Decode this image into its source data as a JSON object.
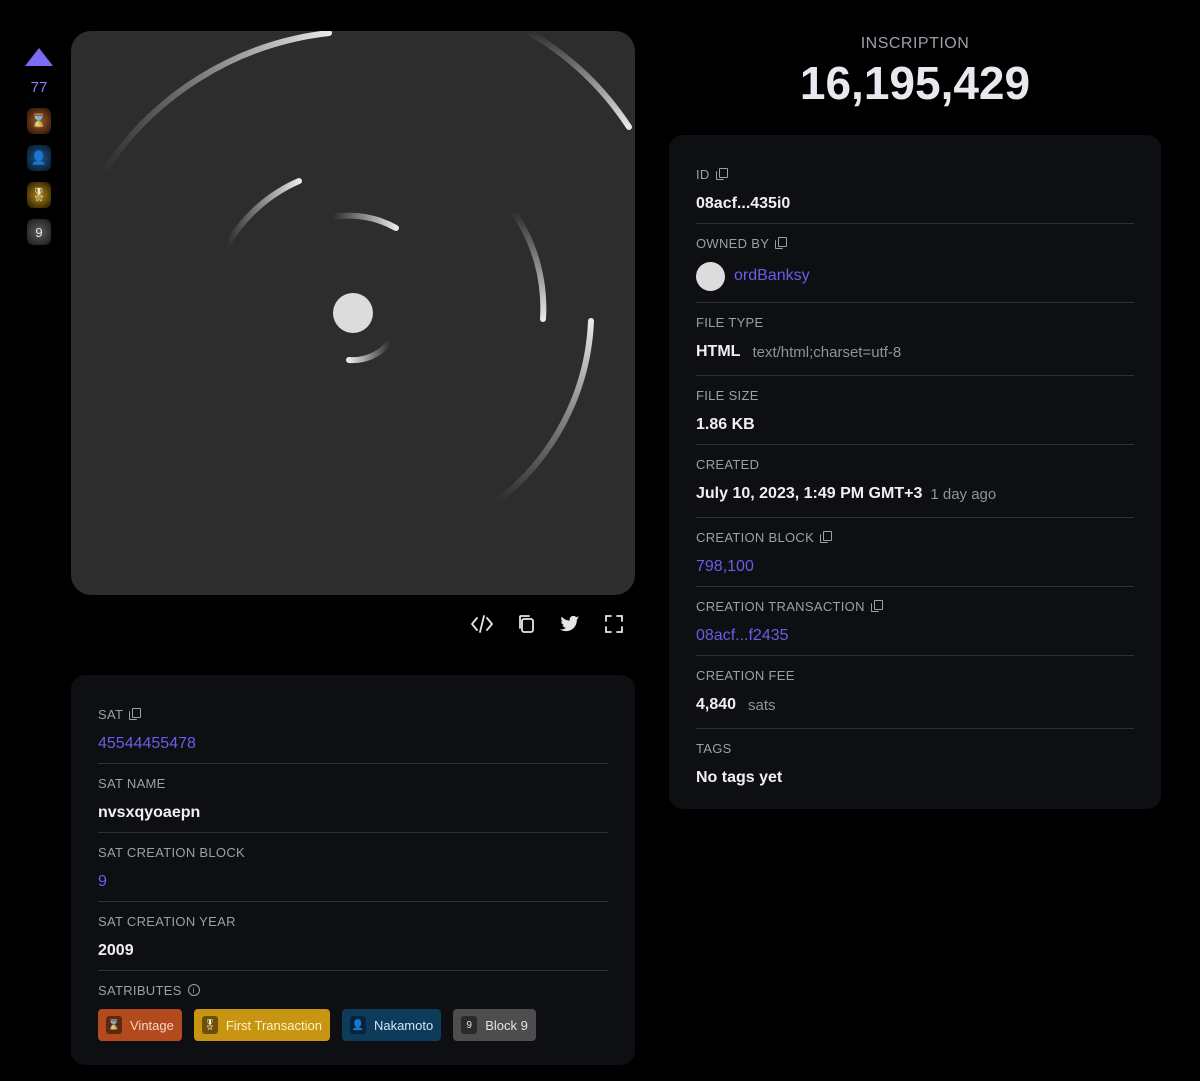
{
  "vote": {
    "count": "77"
  },
  "rail_badges": [
    {
      "icon": "hourglass-icon",
      "glyph": "⌛"
    },
    {
      "icon": "nakamoto-icon",
      "glyph": "👤"
    },
    {
      "icon": "medal-icon",
      "glyph": "🎖"
    },
    {
      "icon": "block-9-icon",
      "glyph": "9"
    }
  ],
  "heading": {
    "label": "INSCRIPTION",
    "number": "16,195,429"
  },
  "actions": [
    {
      "icon": "code-icon"
    },
    {
      "icon": "copy-icon"
    },
    {
      "icon": "twitter-icon"
    },
    {
      "icon": "fullscreen-icon"
    }
  ],
  "sat": {
    "sat_label": "SAT",
    "sat_value": "45544455478",
    "name_label": "SAT NAME",
    "name_value": "nvsxqyoaepn",
    "block_label": "SAT CREATION BLOCK",
    "block_value": "9",
    "year_label": "SAT CREATION YEAR",
    "year_value": "2009",
    "satributes_label": "SATRIBUTES",
    "satributes": [
      {
        "label": "Vintage",
        "glyph": "⌛",
        "icon": "hourglass-icon"
      },
      {
        "label": "First Transaction",
        "glyph": "🎖",
        "icon": "medal-icon"
      },
      {
        "label": "Nakamoto",
        "glyph": "👤",
        "icon": "nakamoto-icon"
      },
      {
        "label": "Block 9",
        "glyph": "9",
        "icon": "block-9-icon"
      }
    ]
  },
  "info": {
    "id_label": "ID",
    "id_value": "08acf...435i0",
    "owner_label": "OWNED BY",
    "owner_value": "ordBanksy",
    "filetype_label": "FILE TYPE",
    "filetype_value": "HTML",
    "filetype_mime": "text/html;charset=utf-8",
    "filesize_label": "FILE SIZE",
    "filesize_value": "1.86 KB",
    "created_label": "CREATED",
    "created_value": "July 10, 2023, 1:49 PM GMT+3",
    "created_relative": "1 day ago",
    "block_label": "CREATION BLOCK",
    "block_value": "798,100",
    "tx_label": "CREATION TRANSACTION",
    "tx_value": "08acf...f2435",
    "fee_label": "CREATION FEE",
    "fee_value": "4,840",
    "fee_unit": "sats",
    "tags_label": "TAGS",
    "tags_value": "No tags yet"
  },
  "colors": {
    "accent": "#6c5ce7",
    "background": "#000000",
    "card": "#0d0f12",
    "preview": "#2d2d2d"
  }
}
